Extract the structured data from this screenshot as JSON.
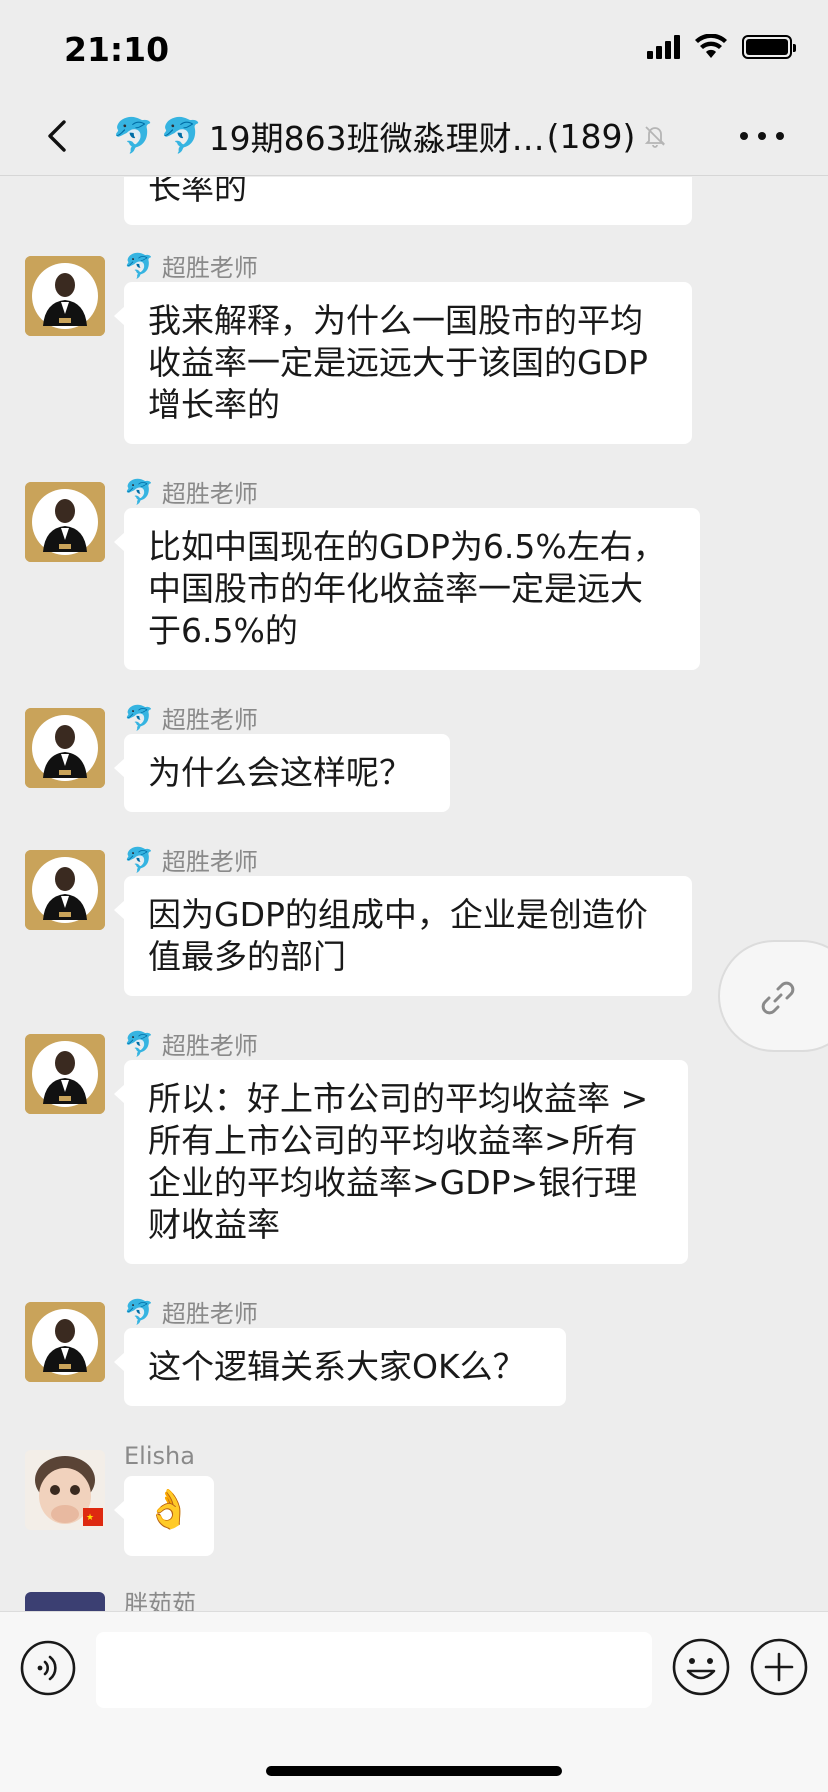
{
  "status": {
    "time": "21:10"
  },
  "nav": {
    "dolphin1": "🐬",
    "dolphin2": "🐬",
    "title": "19期863班微淼理财…",
    "count": "(189)"
  },
  "messages": {
    "partial_top": "长率的",
    "m1": {
      "sender": "超胜老师",
      "lines": [
        "我来解释，为什么一国股市的平均",
        "收益率一定是远远大于该国的GDP",
        "增长率的"
      ]
    },
    "m2": {
      "sender": "超胜老师",
      "lines": [
        "比如中国现在的GDP为6.5%左右，",
        "中国股市的年化收益率一定是远大",
        "于6.5%的"
      ]
    },
    "m3": {
      "sender": "超胜老师",
      "lines": [
        "为什么会这样呢？"
      ]
    },
    "m4": {
      "sender": "超胜老师",
      "lines": [
        "因为GDP的组成中，企业是创造价",
        "值最多的部门"
      ]
    },
    "m5": {
      "sender": "超胜老师",
      "lines": [
        "所以：好上市公司的平均收益率 >",
        "所有上市公司的平均收益率>所有",
        "企业的平均收益率>GDP>银行理",
        "财收益率"
      ]
    },
    "m6": {
      "sender": "超胜老师",
      "lines": [
        "这个逻辑关系大家OK么？"
      ]
    },
    "m7": {
      "sender": "Elisha",
      "emoji": "👌"
    },
    "m8": {
      "sender": "胖茹茹"
    }
  },
  "sender_icon": "🐬",
  "colors": {
    "bubble": "#ffffff",
    "background": "#ededed",
    "avatar_gold": "#c9a35a"
  }
}
